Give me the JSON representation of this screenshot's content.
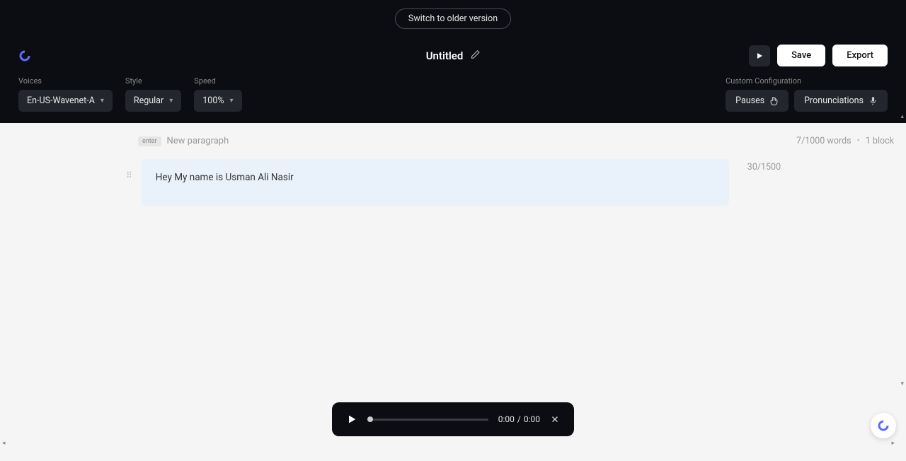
{
  "banner": {
    "switch_label": "Switch to older version"
  },
  "header": {
    "title": "Untitled",
    "save_label": "Save",
    "export_label": "Export"
  },
  "config": {
    "voices_label": "Voices",
    "style_label": "Style",
    "speed_label": "Speed",
    "custom_label": "Custom Configuration",
    "voice_value": "En-US-Wavenet-A",
    "style_value": "Regular",
    "speed_value": "100%",
    "pauses_label": "Pauses",
    "pronunciations_label": "Pronunciations"
  },
  "editor": {
    "enter_key": "enter",
    "hint": "New paragraph",
    "word_stat": "7/1000 words",
    "block_stat": "1 block",
    "char_stat": "30/1500",
    "block_text": "Hey My name is Usman Ali Nasir"
  },
  "player": {
    "current": "0:00",
    "sep": "/",
    "total": "0:00"
  }
}
